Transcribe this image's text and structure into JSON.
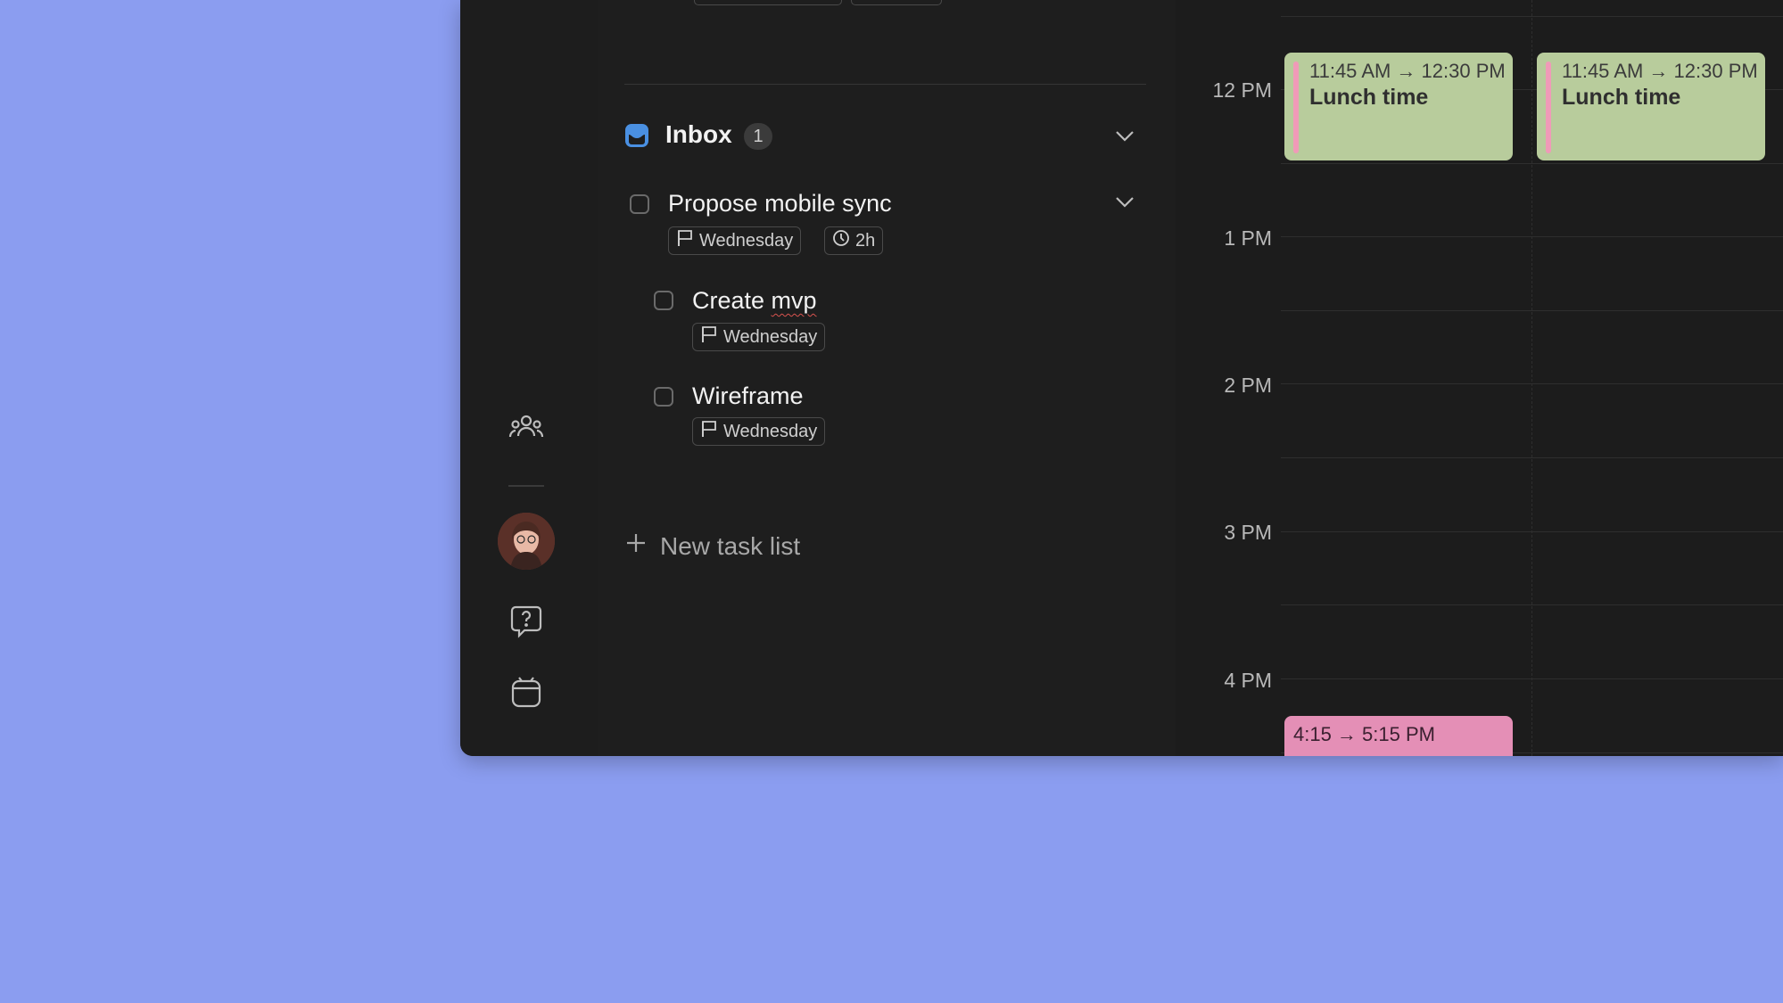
{
  "inbox": {
    "title": "Inbox",
    "count": "1",
    "tasks": [
      {
        "title": "Propose mobile sync",
        "due": "Wednesday",
        "duration": "2h"
      },
      {
        "title": "Create mvp",
        "due": "Wednesday"
      },
      {
        "title": "Wireframe",
        "due": "Wednesday"
      }
    ],
    "new_task_list_label": "New task list"
  },
  "calendar": {
    "hours": [
      "12 PM",
      "1 PM",
      "2 PM",
      "3 PM",
      "4 PM"
    ],
    "events": [
      {
        "time": "11:45 AM → 12:30 PM",
        "title": "Lunch time",
        "color": "#b8cc9c"
      },
      {
        "time": "11:45 AM → 12:30 PM",
        "title": "Lunch time",
        "color": "#b8cc9c"
      },
      {
        "time": "4:15 → 5:15 PM",
        "title": "",
        "color": "#e48fb6"
      }
    ]
  },
  "sidebar": {
    "icons": [
      "people-icon",
      "avatar",
      "help-icon",
      "calendar-app-icon"
    ]
  },
  "colors": {
    "background": "#8b9df0",
    "app": "#1e1e1e",
    "accent": "#4a90e2"
  }
}
